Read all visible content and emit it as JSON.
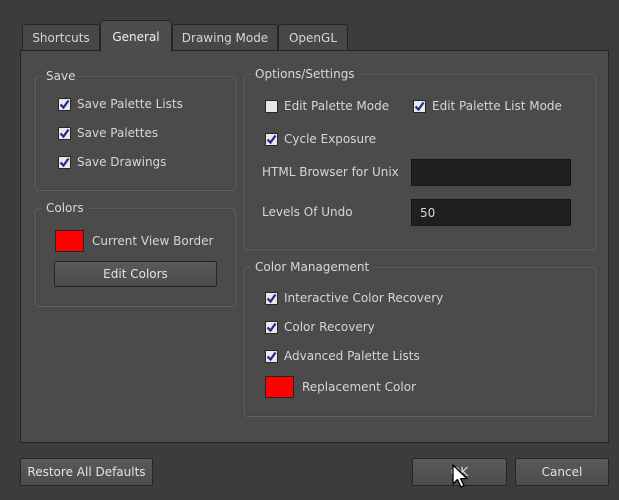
{
  "tabs": [
    {
      "label": "Shortcuts"
    },
    {
      "label": "General"
    },
    {
      "label": "Drawing Mode"
    },
    {
      "label": "OpenGL"
    }
  ],
  "save": {
    "title": "Save",
    "items": [
      {
        "label": "Save Palette Lists",
        "checked": true
      },
      {
        "label": "Save Palettes",
        "checked": true
      },
      {
        "label": "Save Drawings",
        "checked": true
      }
    ]
  },
  "colors": {
    "title": "Colors",
    "view_border_label": "Current View Border",
    "view_border_color": "#ff0000",
    "edit_button": "Edit Colors"
  },
  "options": {
    "title": "Options/Settings",
    "edit_palette_mode": {
      "label": "Edit Palette Mode",
      "checked": false
    },
    "edit_palette_list_mode": {
      "label": "Edit Palette List Mode",
      "checked": true
    },
    "cycle_exposure": {
      "label": "Cycle Exposure",
      "checked": true
    },
    "html_browser_label": "HTML Browser for Unix",
    "html_browser_value": "",
    "levels_of_undo_label": "Levels Of Undo",
    "levels_of_undo_value": "50"
  },
  "color_management": {
    "title": "Color Management",
    "items": [
      {
        "label": "Interactive Color Recovery",
        "checked": true
      },
      {
        "label": "Color Recovery",
        "checked": true
      },
      {
        "label": "Advanced Palette Lists",
        "checked": true
      }
    ],
    "replacement_label": "Replacement Color",
    "replacement_color": "#ff0000"
  },
  "footer": {
    "restore_button": "Restore All Defaults",
    "ok_button": "OK",
    "cancel_button": "Cancel"
  }
}
